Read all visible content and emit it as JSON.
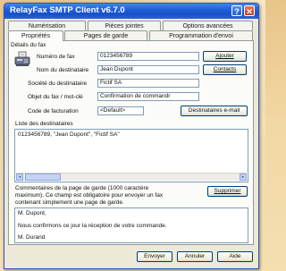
{
  "window": {
    "title": "RelayFax SMTP Client v6.7.0",
    "help_glyph": "?",
    "close_glyph": "✕"
  },
  "tabs": {
    "row1": [
      "Numérisation",
      "Pièces jointes",
      "Options avancées"
    ],
    "row2": [
      "Propriétés",
      "Pages de garde",
      "Programmation d'envoi"
    ],
    "active": "Propriétés"
  },
  "fax_details": {
    "group_label": "Détails du fax",
    "icon": "fax-machine-icon",
    "fields": {
      "fax_number": {
        "label": "Numéro de fax",
        "value": "0123456789"
      },
      "recipient_name": {
        "label": "Nom du destinataire",
        "value": "Jean Dupont"
      },
      "recipient_company": {
        "label": "Société du destinataire",
        "value": "Fictif SA"
      },
      "subject": {
        "label": "Objet du fax / mot-clé",
        "value": "Confirmation de commandr"
      },
      "billing_code": {
        "label": "Code de facturation",
        "value": "<Default>"
      }
    },
    "buttons": {
      "add": "Ajouter",
      "contacts": "Contacts",
      "email_recipients": "Destinataires e-mail"
    }
  },
  "recipients": {
    "label": "Liste des destinataires",
    "items": [
      "0123456789, \"Jean Dupont\", \"Fictif SA\""
    ],
    "scroll_left": "◂",
    "scroll_right": "▸"
  },
  "cover_comments": {
    "label": "Commentaires de la page de garde (1000 caractères maximum). Ce champ est obligatoire pour envoyer un fax contenant simplement une page de garde.",
    "label_lines": [
      "Commentaires de la page de garde (1000 caractère",
      "maximum). Ce champ est obligatoire pour envoyer un fax",
      "contenant simplement une page de garde."
    ],
    "delete_button": "Supprimer",
    "text": [
      "M. Dupont,",
      "",
      "Nous confirmons ce jour la réception de votre commande.",
      "",
      "M. Durand"
    ]
  },
  "footer": {
    "send": "Envoyer",
    "cancel": "Annuler",
    "help": "Aide"
  },
  "colors": {
    "titlebar": "#1f5fd8",
    "dialog": "#ece9d8",
    "desktop": "#f2d8a4"
  }
}
